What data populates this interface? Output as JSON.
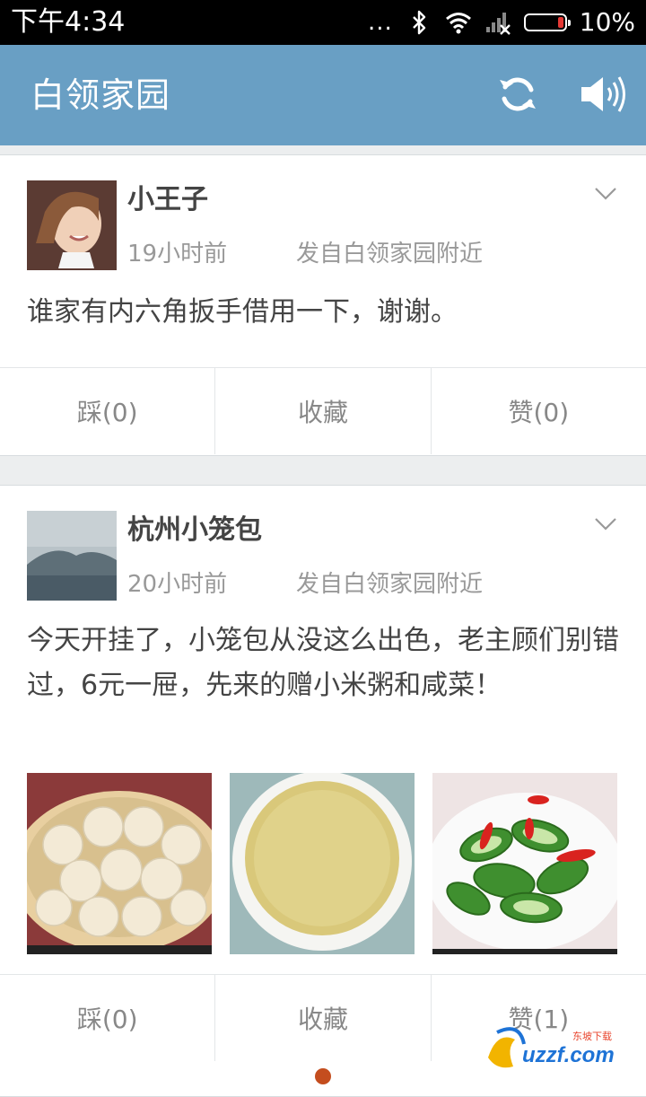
{
  "status_bar": {
    "time": "下午4:34",
    "dots": "...",
    "battery_text": "10%",
    "icons": [
      "bluetooth-icon",
      "wifi-icon",
      "signal-icon",
      "battery-icon"
    ]
  },
  "app_bar": {
    "title": "白领家园",
    "icons": [
      "refresh-icon",
      "speaker-icon"
    ],
    "color": "#699fc4"
  },
  "posts": [
    {
      "username": "小王子",
      "time": "19小时前",
      "location": "发自白领家园附近",
      "text": "谁家有内六角扳手借用一下，谢谢。",
      "images": [],
      "actions": {
        "dislike": "踩(0)",
        "favorite": "收藏",
        "like": "赞(0)"
      }
    },
    {
      "username": "杭州小笼包",
      "time": "20小时前",
      "location": "发自白领家园附近",
      "text": "今天开挂了，小笼包从没这么出色，老主顾们别错过，6元一屉，先来的赠小米粥和咸菜！",
      "images": [
        "dumplings-photo",
        "millet-porridge-photo",
        "pickled-cucumber-photo"
      ],
      "actions": {
        "dislike": "踩(0)",
        "favorite": "收藏",
        "like": "赞(1)"
      }
    }
  ],
  "watermark": {
    "brand": "uzzf.com",
    "subtitle": "东坡下载"
  }
}
